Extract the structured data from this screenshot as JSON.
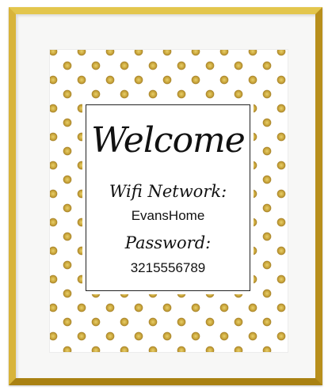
{
  "sign": {
    "heading": "Welcome",
    "wifi_label": "Wifi Network:",
    "network_name": "EvansHome",
    "password_label": "Password:",
    "password": "3215556789"
  },
  "colors": {
    "frame_gold": "#c9a227",
    "dot_gold": "#c9a53a",
    "mat": "#f7f7f6",
    "text": "#111111"
  }
}
